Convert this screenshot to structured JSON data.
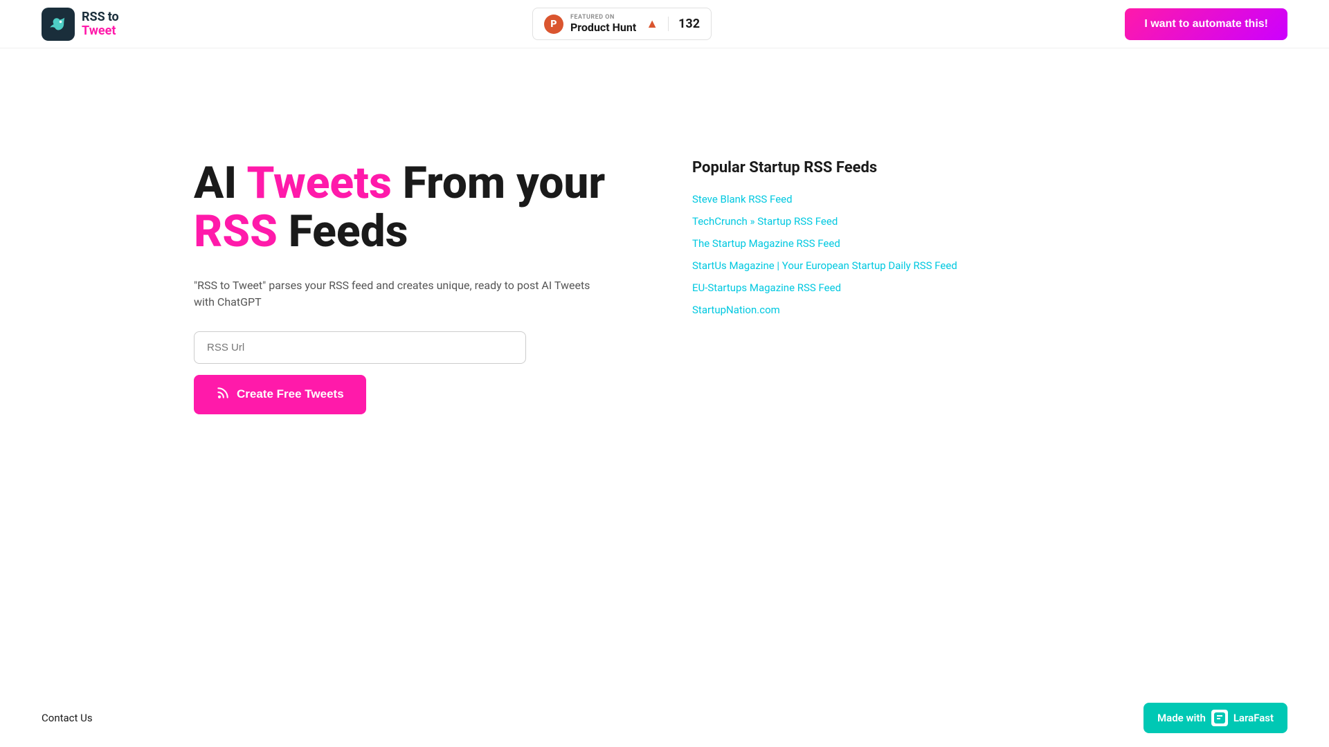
{
  "header": {
    "logo": {
      "rss": "RSS",
      "to": "to",
      "tweet": "Tweet",
      "bird_icon": "🐦"
    },
    "product_hunt": {
      "featured_label": "FEATURED ON",
      "name": "Product Hunt",
      "count": "132",
      "arrow": "▲"
    },
    "automate_button": "I want to automate this!"
  },
  "hero": {
    "title_part1": "AI ",
    "title_pink1": "Tweets",
    "title_part2": " From your",
    "title_pink2": "RSS",
    "title_part3": " Feeds",
    "subtitle": "\"RSS to Tweet\" parses your RSS feed and creates unique, ready to post AI Tweets with ChatGPT",
    "input_placeholder": "RSS Url",
    "button_label": "Create Free Tweets"
  },
  "sidebar": {
    "title": "Popular Startup RSS Feeds",
    "feeds": [
      {
        "label": "Steve Blank RSS Feed",
        "url": "#"
      },
      {
        "label": "TechCrunch » Startup RSS Feed",
        "url": "#"
      },
      {
        "label": "The Startup Magazine RSS Feed",
        "url": "#"
      },
      {
        "label": "StartUs Magazine | Your European Startup Daily RSS Feed",
        "url": "#"
      },
      {
        "label": "EU-Startups Magazine RSS Feed",
        "url": "#"
      },
      {
        "label": "StartupNation.com",
        "url": "#"
      }
    ]
  },
  "footer": {
    "contact_label": "Contact Us",
    "made_with_label": "Made with",
    "larafast_label": "LaraFast"
  }
}
